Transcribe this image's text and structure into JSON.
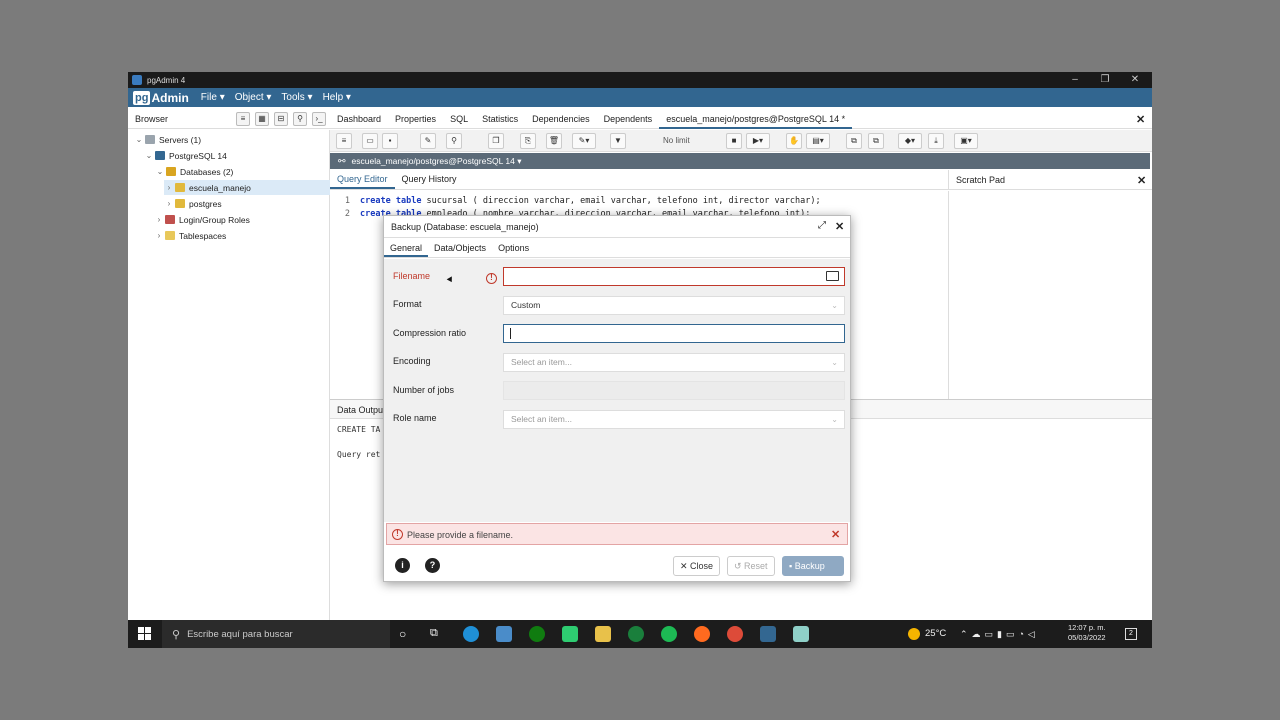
{
  "window": {
    "title": "pgAdmin 4",
    "controls": [
      "–",
      "❐",
      "✕"
    ]
  },
  "menubar": {
    "logo_pg": "pg",
    "logo_admin": "Admin",
    "items": [
      "File ▾",
      "Object ▾",
      "Tools ▾",
      "Help ▾"
    ]
  },
  "browser": {
    "label": "Browser",
    "tree": [
      {
        "chev": "⌄",
        "label": "Servers (1)"
      },
      {
        "chev": "⌄",
        "label": "PostgreSQL 14"
      },
      {
        "chev": "⌄",
        "label": "Databases (2)"
      },
      {
        "chev": "›",
        "label": "escuela_manejo"
      },
      {
        "chev": "›",
        "label": "postgres"
      },
      {
        "chev": "›",
        "label": "Login/Group Roles"
      },
      {
        "chev": "›",
        "label": "Tablespaces"
      }
    ]
  },
  "main_tabs": [
    "Dashboard",
    "Properties",
    "SQL",
    "Statistics",
    "Dependencies",
    "Dependents",
    "escuela_manejo/postgres@PostgreSQL 14 *"
  ],
  "toolbar": {
    "limit": "No limit"
  },
  "connection": {
    "label": "escuela_manejo/postgres@PostgreSQL 14 ▾"
  },
  "query_tabs": [
    "Query Editor",
    "Query History"
  ],
  "scratch_pad": "Scratch Pad",
  "editor": {
    "lines": [
      {
        "n": "1",
        "kw1": "create",
        "kw2": "table",
        "rest": " sucursal ( direccion varchar, email varchar, telefono int, director varchar);"
      },
      {
        "n": "2",
        "kw1": "create",
        "kw2": "table",
        "rest": " empleado ( nombre varchar, direccion varchar, email varchar, telefono int);"
      }
    ]
  },
  "output": {
    "tab": "Data Output",
    "line1": "CREATE TA",
    "line2": "Query ret"
  },
  "dialog": {
    "title": "Backup (Database: escuela_manejo)",
    "tabs": [
      "General",
      "Data/Objects",
      "Options"
    ],
    "fields": {
      "filename_label": "Filename",
      "filename_value": "",
      "format_label": "Format",
      "format_value": "Custom",
      "compression_label": "Compression ratio",
      "compression_value": "",
      "encoding_label": "Encoding",
      "encoding_placeholder": "Select an item...",
      "jobs_label": "Number of jobs",
      "jobs_value": "",
      "role_label": "Role name",
      "role_placeholder": "Select an item..."
    },
    "error": "Please provide a filename.",
    "buttons": {
      "info": "i",
      "help": "?",
      "close": "✕ Close",
      "reset": "↺ Reset",
      "backup": "Backup"
    }
  },
  "taskbar": {
    "search_placeholder": "Escribe aquí para buscar",
    "weather": "25°C",
    "time": "12:07 p. m.",
    "date": "05/03/2022",
    "notifications": "2"
  }
}
